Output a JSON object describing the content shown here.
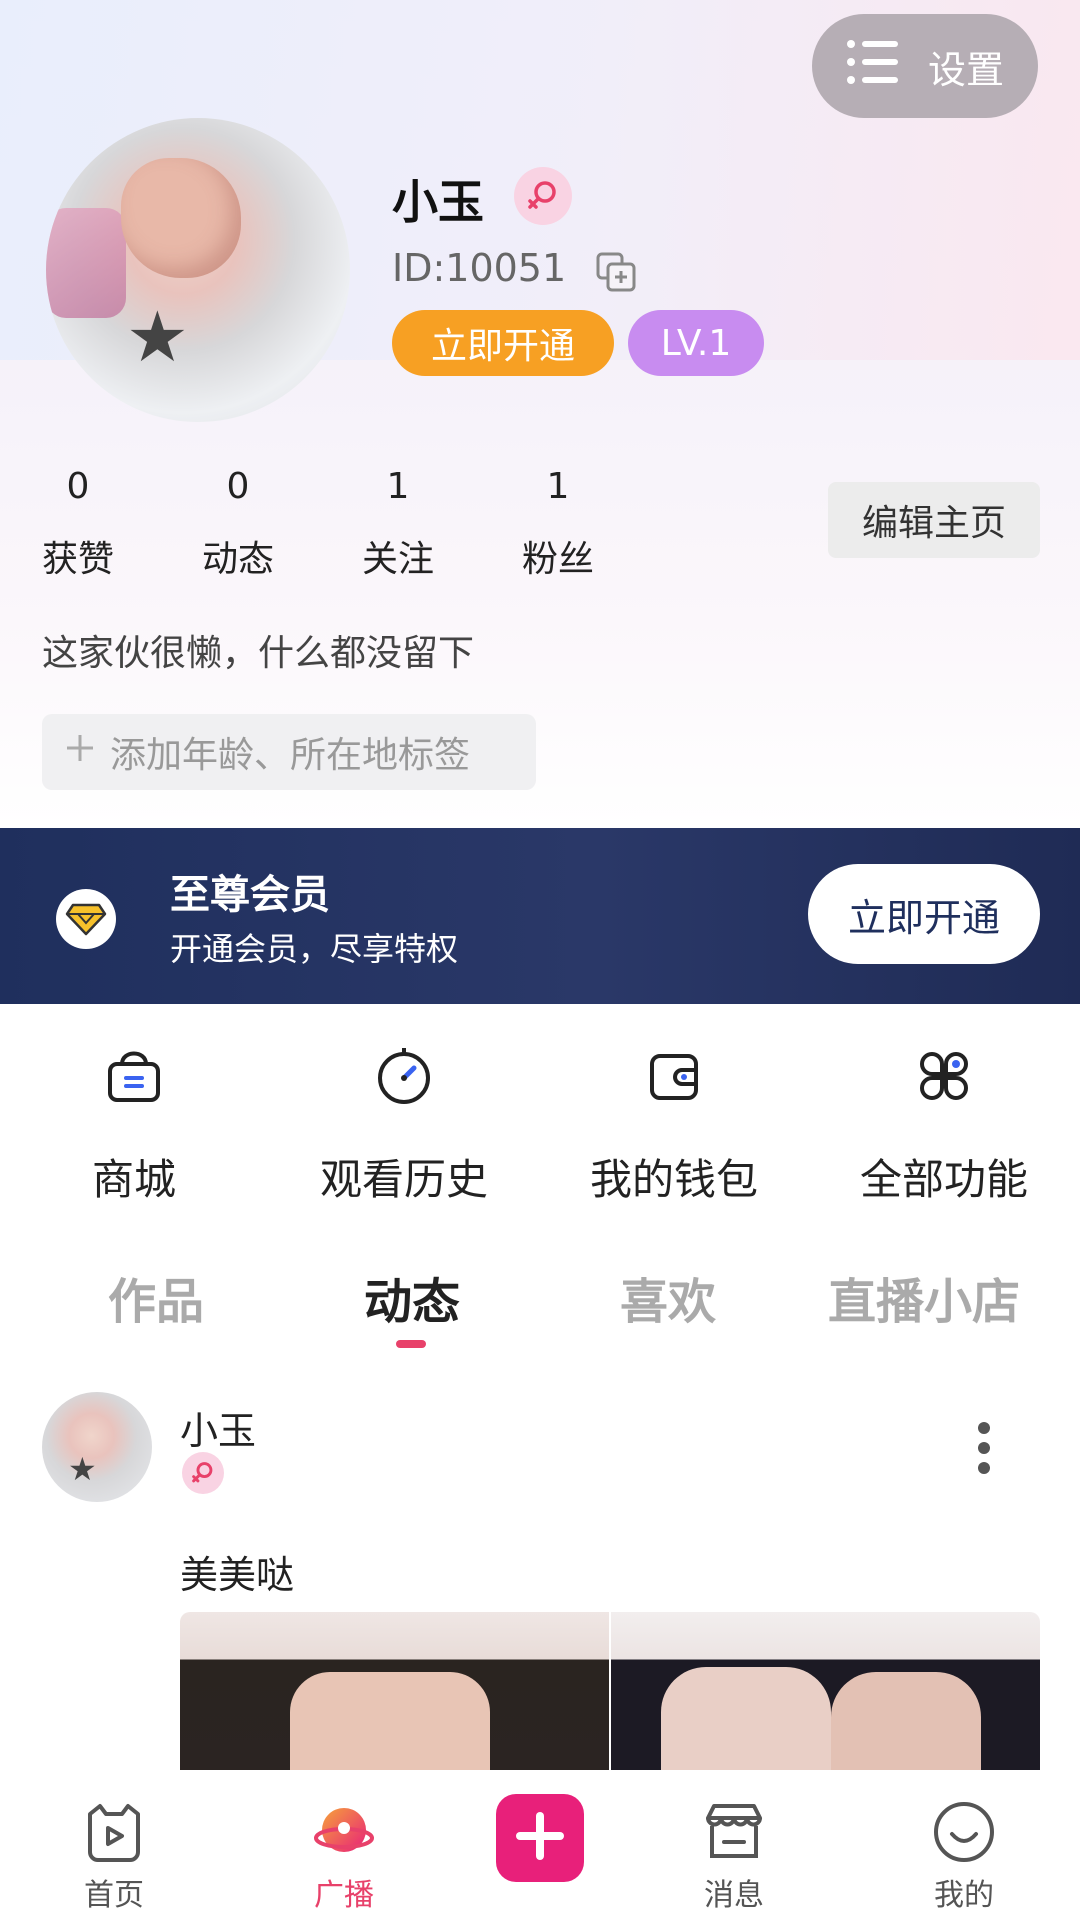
{
  "header": {
    "settings_label": "设置",
    "profile": {
      "name": "小玉",
      "id_text": "ID:10051",
      "vip_button": "立即开通",
      "level": "LV.1"
    },
    "stats": [
      {
        "value": "0",
        "label": "获赞"
      },
      {
        "value": "0",
        "label": "动态"
      },
      {
        "value": "1",
        "label": "关注"
      },
      {
        "value": "1",
        "label": "粉丝"
      }
    ],
    "edit_button": "编辑主页",
    "bio": "这家伙很懒，什么都没留下",
    "add_tag": "添加年龄、所在地标签"
  },
  "vip_banner": {
    "title": "至尊会员",
    "subtitle": "开通会员，尽享特权",
    "button": "立即开通"
  },
  "features": [
    {
      "label": "商城",
      "icon": "shop-bag-icon"
    },
    {
      "label": "观看历史",
      "icon": "history-clock-icon"
    },
    {
      "label": "我的钱包",
      "icon": "wallet-icon"
    },
    {
      "label": "全部功能",
      "icon": "all-functions-icon"
    }
  ],
  "tabs": [
    "作品",
    "动态",
    "喜欢",
    "直播小店"
  ],
  "active_tab": "动态",
  "post": {
    "author": "小玉",
    "text": "美美哒"
  },
  "bottom_nav": [
    {
      "label": "首页",
      "icon": "home-tv-icon"
    },
    {
      "label": "广播",
      "icon": "broadcast-icon"
    },
    {
      "label": "",
      "icon": "publish-plus-icon"
    },
    {
      "label": "消息",
      "icon": "message-store-icon"
    },
    {
      "label": "我的",
      "icon": "profile-smile-icon"
    }
  ],
  "colors": {
    "accent_pink": "#e8416a",
    "vip_orange": "#f7a023",
    "level_purple": "#c88cf0",
    "vip_banner_navy": "#24325f",
    "publish_magenta": "#e8207a"
  }
}
